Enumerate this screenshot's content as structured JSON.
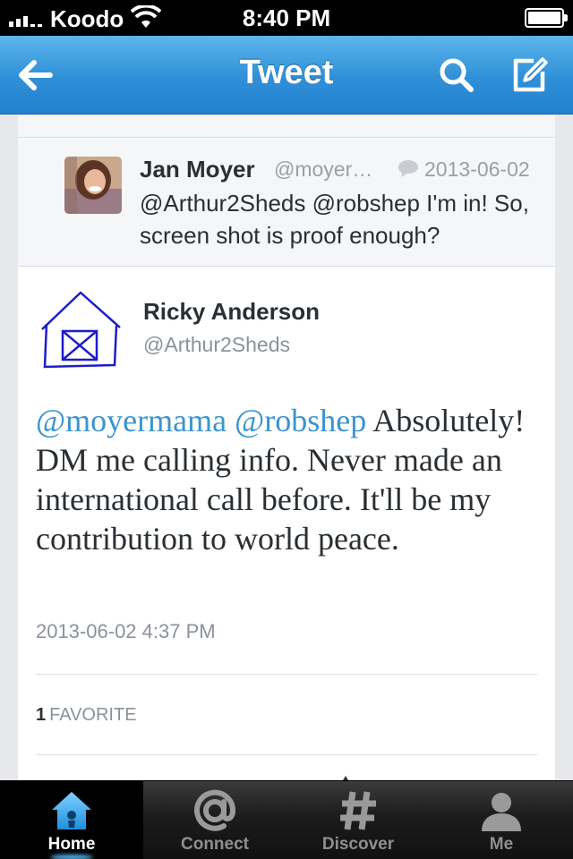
{
  "status_bar": {
    "carrier": "Koodo",
    "time": "8:40 PM",
    "icons": [
      "signal-icon",
      "wifi-icon",
      "battery-icon"
    ]
  },
  "nav_bar": {
    "title": "Tweet",
    "icons": [
      "back-arrow-icon",
      "search-icon",
      "compose-icon"
    ]
  },
  "reply_tweet": {
    "name": "Jan Moyer",
    "handle": "@moyer…",
    "date": "2013-06-02",
    "text": "@Arthur2Sheds @robshep I'm in! So, screen shot is proof enough?",
    "icons": [
      "avatar",
      "reply-bubble-icon"
    ]
  },
  "main_tweet": {
    "name": "Ricky Anderson",
    "handle": "@Arthur2Sheds",
    "mention_1": "@moyermama",
    "mention_2": "@robshep",
    "body": "Absolutely! DM me calling info. Never made an international call before. It'll be my contribution to world peace.",
    "timestamp": "2013-06-02 4:37 PM",
    "favorite_count": "1",
    "favorite_label": "FAVORITE",
    "icons": [
      "shed-avatar"
    ]
  },
  "tab_bar": {
    "active": "Home",
    "tabs": [
      {
        "label": "Home",
        "icon": "home-icon"
      },
      {
        "label": "Connect",
        "icon": "at-icon"
      },
      {
        "label": "Discover",
        "icon": "hash-icon"
      },
      {
        "label": "Me",
        "icon": "person-icon"
      }
    ]
  },
  "colors": {
    "nav_blue": "#2f8fd7",
    "mention_blue": "#3a94d0",
    "tab_bar": "#1c1c1c"
  }
}
